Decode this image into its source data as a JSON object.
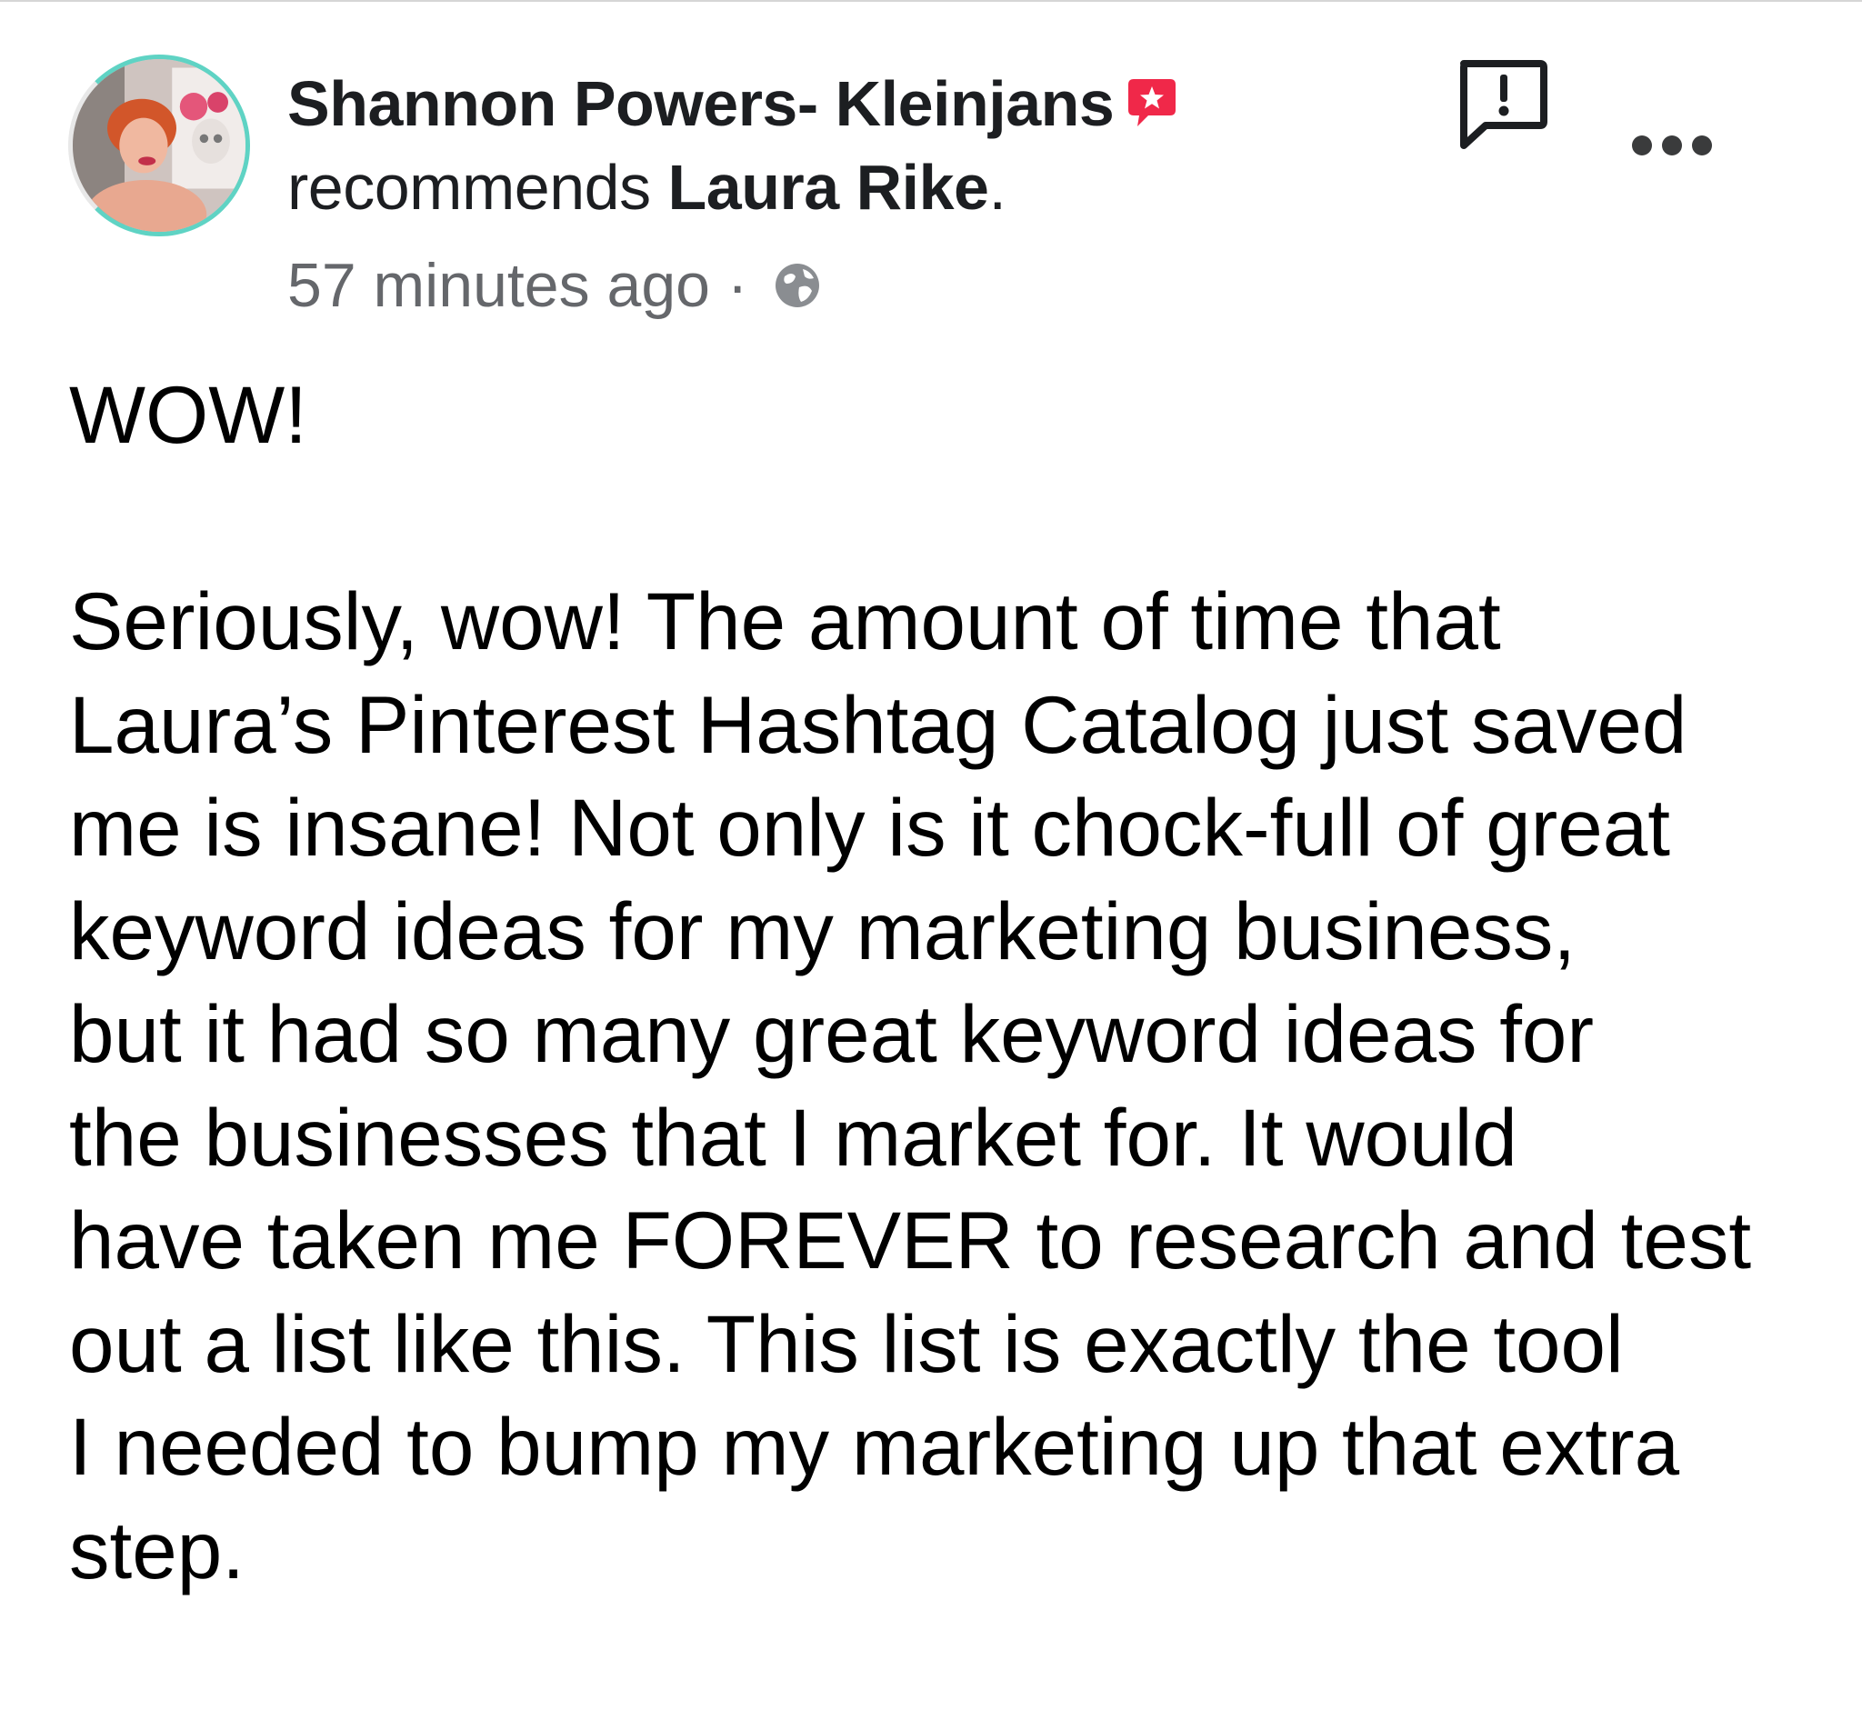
{
  "post": {
    "author_name": "Shannon Powers- Kleinjans",
    "recommends_prefix": "recommends ",
    "recommended_name": "Laura Rike",
    "recommends_suffix": ".",
    "timestamp": "57 minutes ago",
    "separator": " · ",
    "privacy_icon": "globe-icon",
    "recommend_badge_icon": "recommendation-star-icon",
    "actions": {
      "report_icon": "report-icon",
      "more_icon": "more-options-icon"
    },
    "body": "WOW!\n\nSeriously, wow! The amount of time that\nLaura’s Pinterest Hashtag Catalog just saved\nme is insane! Not only is it chock-full of great\nkeyword ideas for my marketing business,\nbut it had so many great keyword ideas for\nthe businesses that I market for. It would\nhave taken me FOREVER to research and test\nout a list like this.  This list is exactly the tool\nI needed to bump my marketing up that extra\nstep."
  },
  "colors": {
    "recommend_badge": "#f02849",
    "meta_text": "#65676b",
    "avatar_ring": "#5fd3c4"
  }
}
